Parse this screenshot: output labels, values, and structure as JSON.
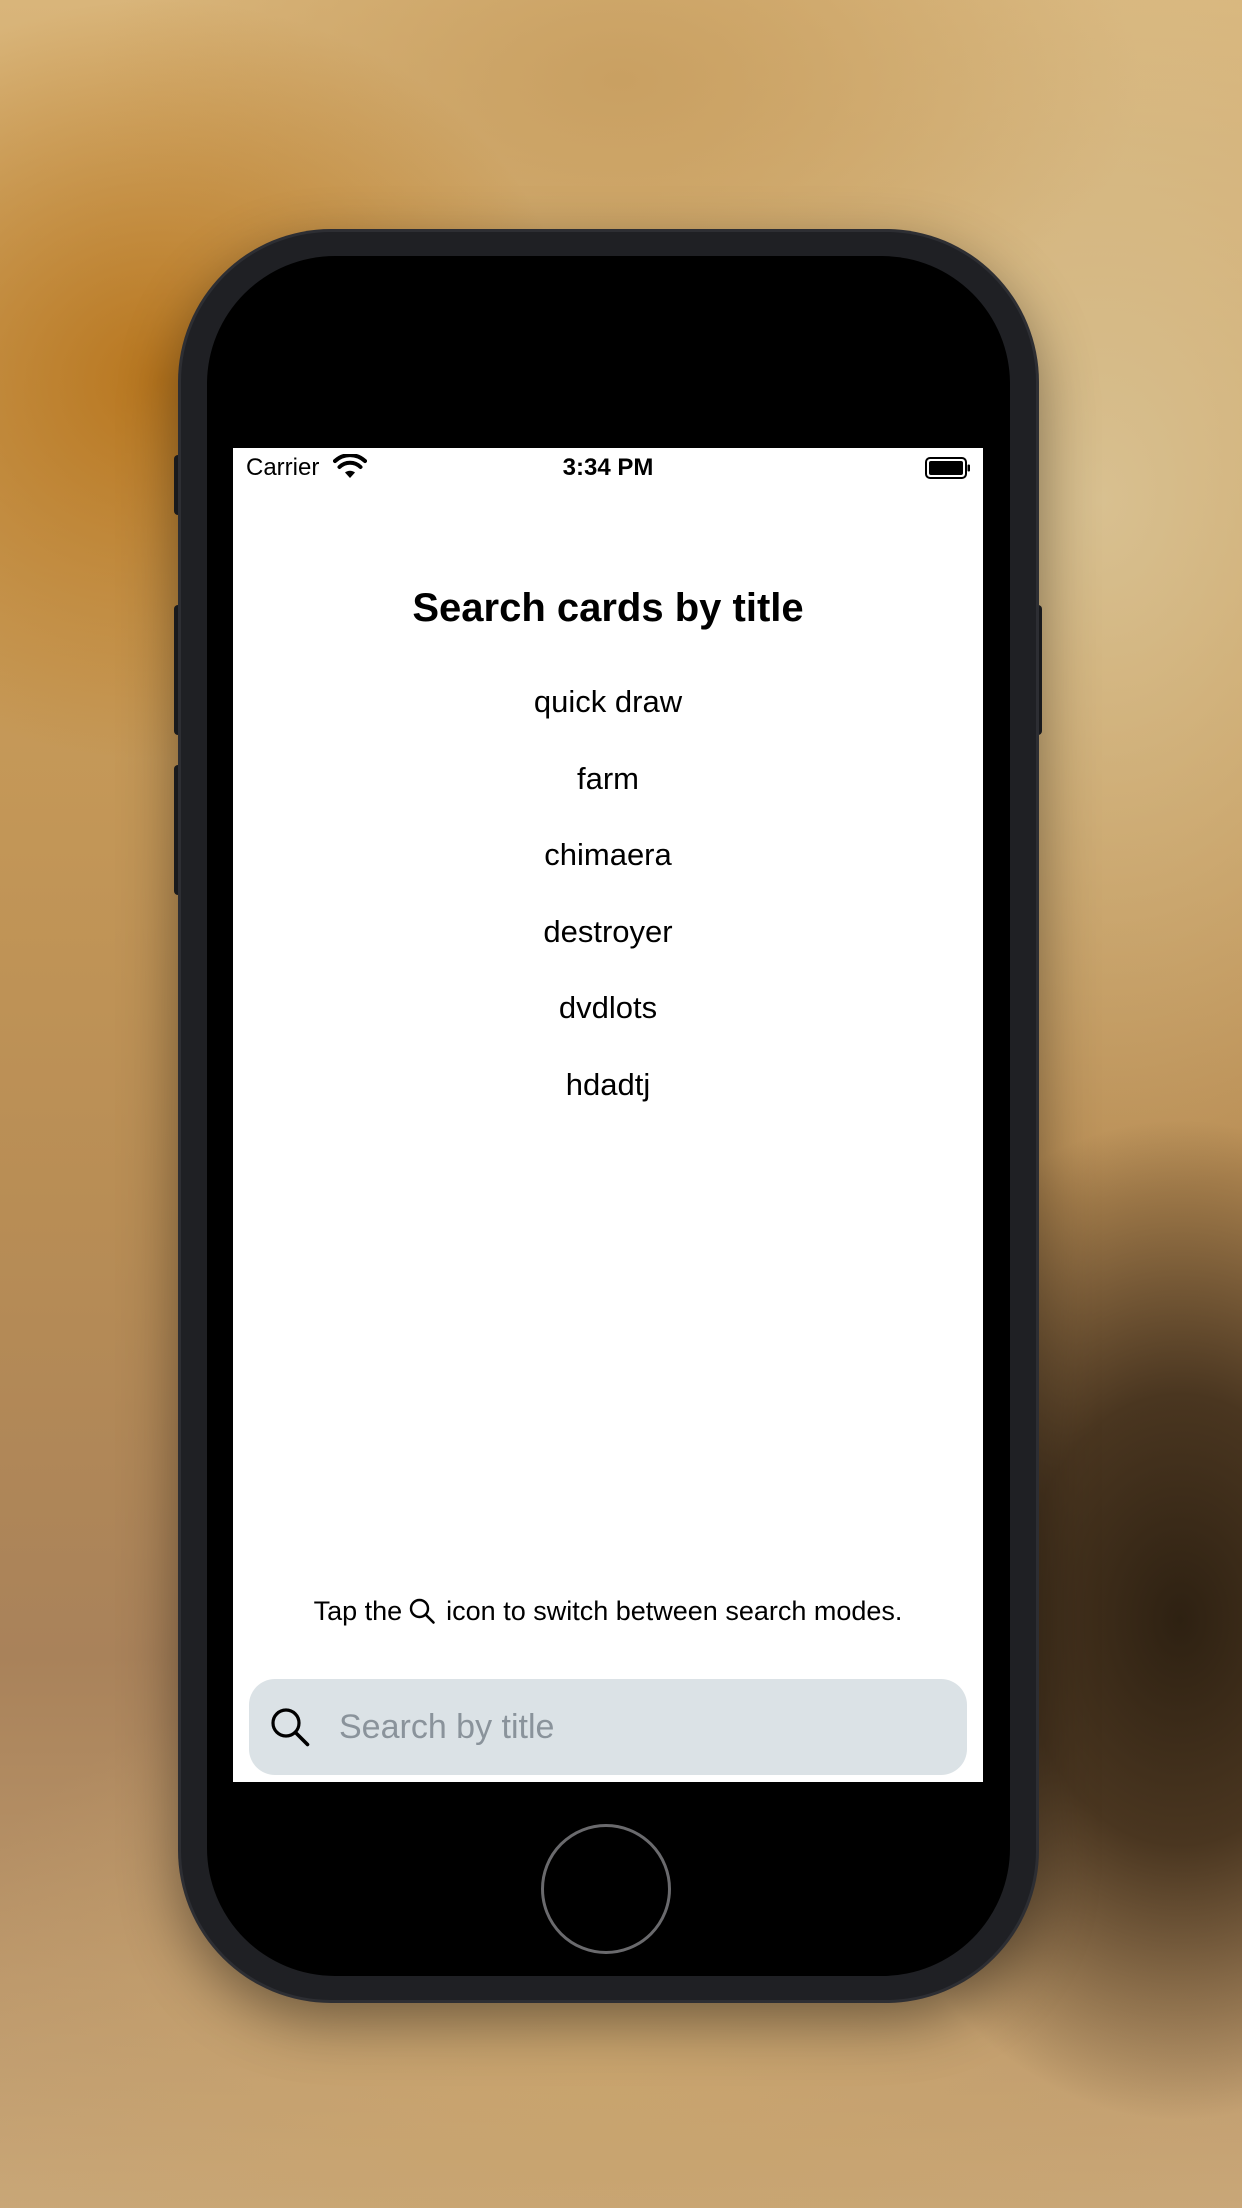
{
  "status_bar": {
    "carrier": "Carrier",
    "time": "3:34 PM",
    "wifi_icon": "wifi-icon",
    "battery_icon": "battery-full-icon"
  },
  "page": {
    "title": "Search cards by title"
  },
  "results": [
    {
      "label": "quick draw"
    },
    {
      "label": "farm"
    },
    {
      "label": "chimaera"
    },
    {
      "label": "destroyer"
    },
    {
      "label": "dvdlots"
    },
    {
      "label": "hdadtj"
    }
  ],
  "hint": {
    "before": "Tap the",
    "icon": "search-icon",
    "after": "icon to switch between search modes."
  },
  "search": {
    "icon": "search-icon",
    "placeholder": "Search by title",
    "value": ""
  },
  "colors": {
    "search_bar_background": "#dbe2e6",
    "placeholder_text": "#8a939b",
    "screen_background": "#ffffff",
    "device_frame": "#1f2024"
  }
}
